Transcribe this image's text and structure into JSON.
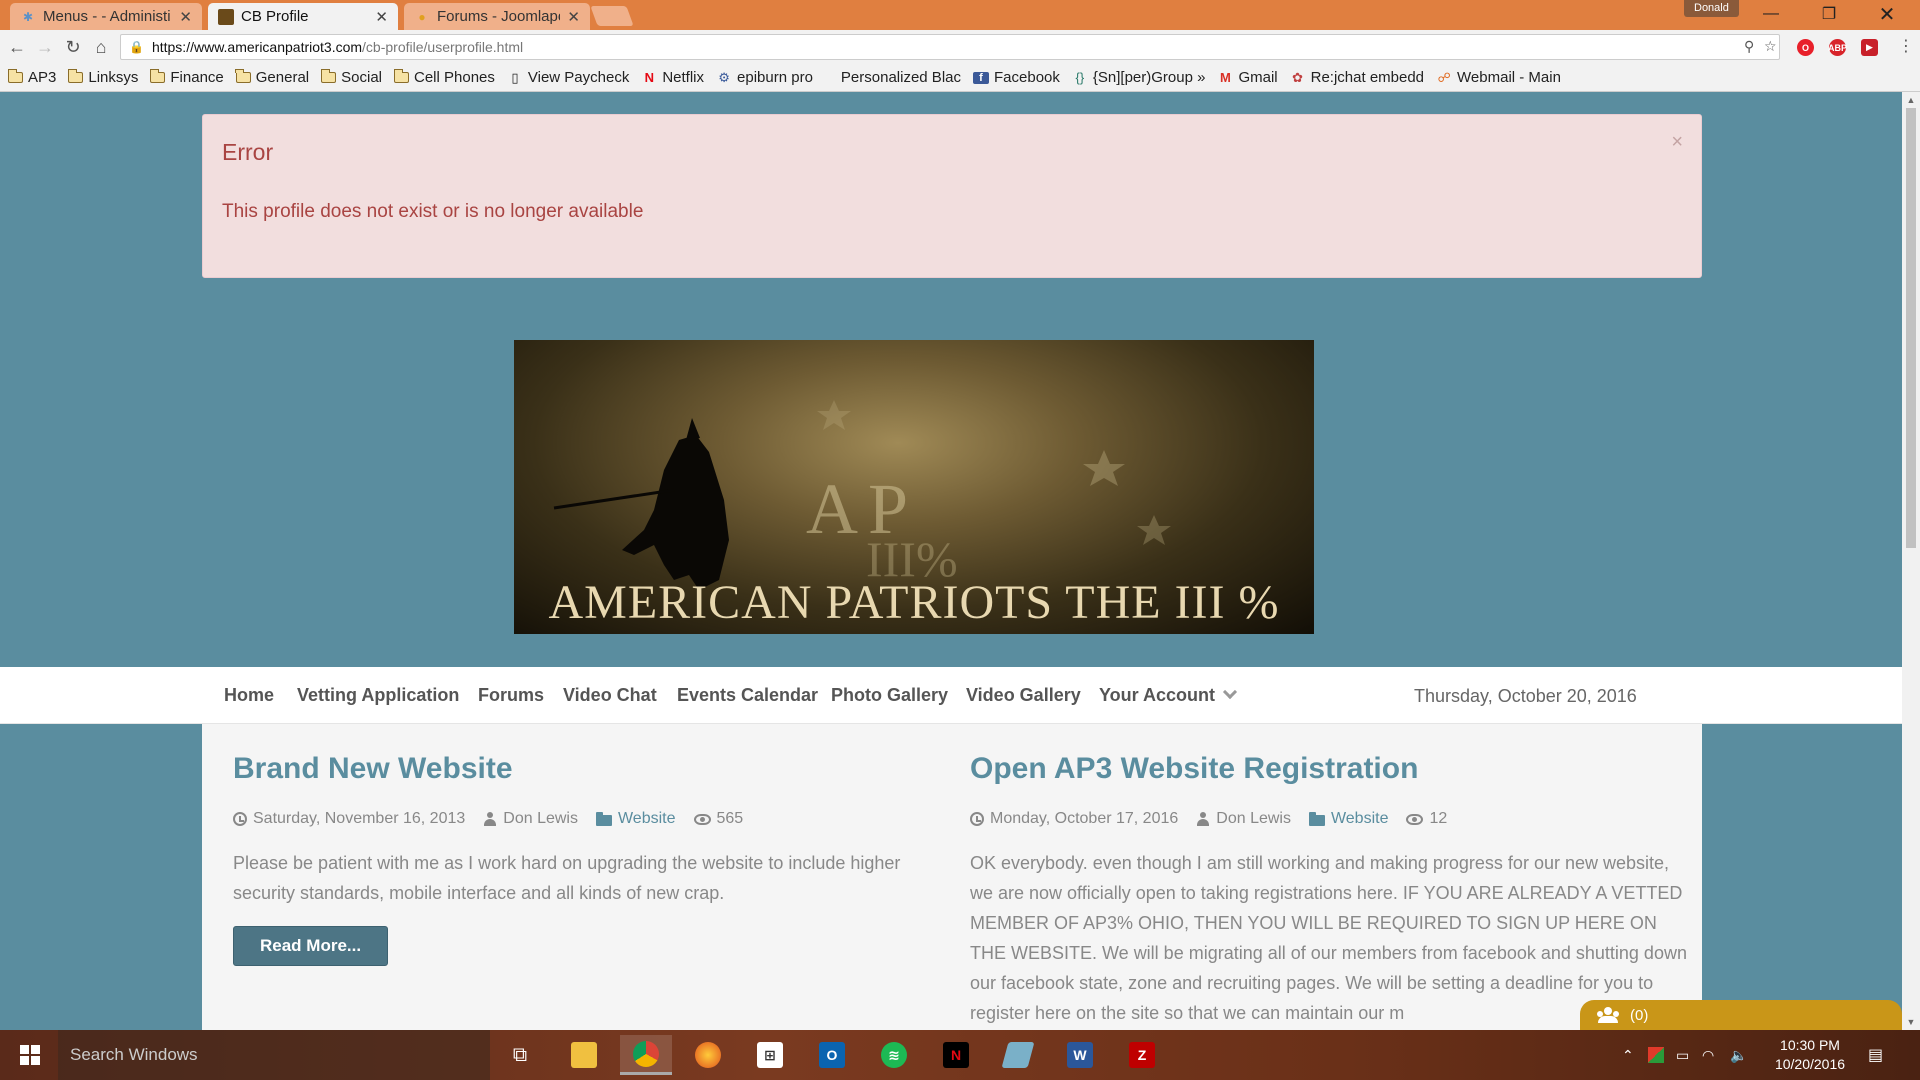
{
  "browser": {
    "tabs": [
      {
        "label": "Menus - - Administi",
        "active": false
      },
      {
        "label": "CB Profile",
        "active": true
      },
      {
        "label": "Forums - Joomlapol",
        "active": false
      }
    ],
    "profile_name": "Donald",
    "url_host": "https://www.americanpatriot3.com",
    "url_path": "/cb-profile/userprofile.html",
    "bookmarks": [
      {
        "label": "AP3",
        "icon": "folder-icon"
      },
      {
        "label": "Linksys",
        "icon": "folder-icon"
      },
      {
        "label": "Finance",
        "icon": "folder-icon"
      },
      {
        "label": "General",
        "icon": "folder-icon"
      },
      {
        "label": "Social",
        "icon": "folder-icon"
      },
      {
        "label": "Cell Phones",
        "icon": "folder-icon"
      },
      {
        "label": "View Paycheck",
        "icon": "page-icon"
      },
      {
        "label": "Netflix",
        "icon": "netflix-icon"
      },
      {
        "label": "epiburn pro",
        "icon": "epiburn-icon"
      },
      {
        "label": "Personalized Blac",
        "icon": "blank-icon"
      },
      {
        "label": "Facebook",
        "icon": "facebook-icon"
      },
      {
        "label": "{Sn][per)Group »",
        "icon": "group-icon"
      },
      {
        "label": "Gmail",
        "icon": "gmail-icon"
      },
      {
        "label": "Re:jchat embedd",
        "icon": "jchat-icon"
      },
      {
        "label": "Webmail - Main",
        "icon": "webmail-icon"
      }
    ]
  },
  "alert": {
    "title": "Error",
    "message": "This profile does not exist or is no longer available",
    "close": "×"
  },
  "banner": {
    "caption": "AMERICAN PATRIOTS THE III %",
    "logo_text": "AP",
    "logo_sub": "III%"
  },
  "nav": {
    "items": [
      "Home",
      "Vetting Application",
      "Forums",
      "Video Chat",
      "Events Calendar",
      "Photo Gallery",
      "Video Gallery",
      "Your Account"
    ],
    "date": "Thursday, October 20, 2016"
  },
  "articles": [
    {
      "title": "Brand New Website",
      "date": "Saturday, November 16, 2013",
      "author": "Don Lewis",
      "category": "Website",
      "views": "565",
      "body": "Please be patient with me as I work hard on upgrading the website to include higher security standards, mobile interface and all kinds of new crap.",
      "read_more": "Read More..."
    },
    {
      "title": "Open AP3 Website Registration",
      "date": "Monday, October 17, 2016",
      "author": "Don Lewis",
      "category": "Website",
      "views": "12",
      "body": "OK everybody. even though I am still working and making progress for our new website, we are now officially open to taking registrations here. IF YOU ARE ALREADY A VETTED MEMBER OF AP3% OHIO, THEN YOU WILL BE REQUIRED TO SIGN UP HERE ON THE WEBSITE. We will be migrating all of our members from facebook and shutting down our facebook state, zone and recruiting pages. We will be setting a deadline for you to register here on the site so that we can maintain our m"
    }
  ],
  "chat": {
    "count": "(0)"
  },
  "taskbar": {
    "search_placeholder": "Search Windows",
    "time": "10:30 PM",
    "date": "10/20/2016"
  },
  "colors": {
    "accent": "#5a8d9f",
    "alert_text": "#a94442",
    "alert_bg": "#f2dede",
    "button": "#4d7585"
  }
}
